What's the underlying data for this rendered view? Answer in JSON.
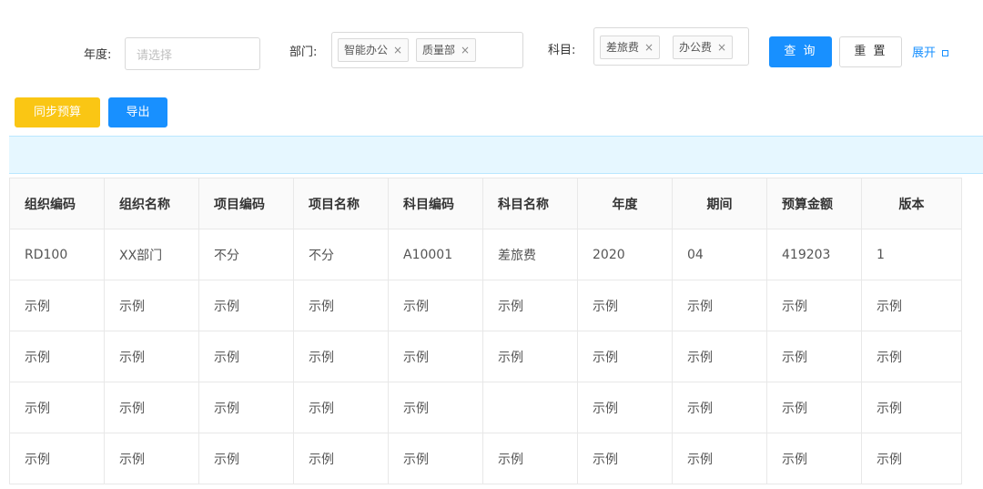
{
  "filters": {
    "year": {
      "label": "年度:",
      "placeholder": "请选择"
    },
    "dept": {
      "label": "部门:",
      "tags": [
        "智能办公",
        "质量部"
      ]
    },
    "subject": {
      "label": "科目:",
      "tags": [
        "差旅费",
        "办公费"
      ]
    },
    "tag_close": "×",
    "query_label": "查 询",
    "reset_label": "重 置",
    "expand_label": "展开"
  },
  "toolbar": {
    "sync_label": "同步预算",
    "export_label": "导出"
  },
  "colors": {
    "primary": "#1890ff",
    "warning": "#fac614",
    "info_bg": "#e6f7ff"
  },
  "table": {
    "columns": [
      "组织编码",
      "组织名称",
      "项目编码",
      "项目名称",
      "科目编码",
      "科目名称",
      "年度",
      "期间",
      "预算金额",
      "版本"
    ],
    "rows": [
      [
        "RD100",
        "XX部门",
        "不分",
        "不分",
        "A10001",
        "差旅费",
        "2020",
        "04",
        "419203",
        "1"
      ],
      [
        "示例",
        "示例",
        "示例",
        "示例",
        "示例",
        "示例",
        "示例",
        "示例",
        "示例",
        "示例"
      ],
      [
        "示例",
        "示例",
        "示例",
        "示例",
        "示例",
        "示例",
        "示例",
        "示例",
        "示例",
        "示例"
      ],
      [
        "示例",
        "示例",
        "示例",
        "示例",
        "示例",
        "",
        "示例",
        "示例",
        "示例",
        "示例"
      ],
      [
        "示例",
        "示例",
        "示例",
        "示例",
        "示例",
        "示例",
        "示例",
        "示例",
        "示例",
        "示例"
      ]
    ]
  }
}
